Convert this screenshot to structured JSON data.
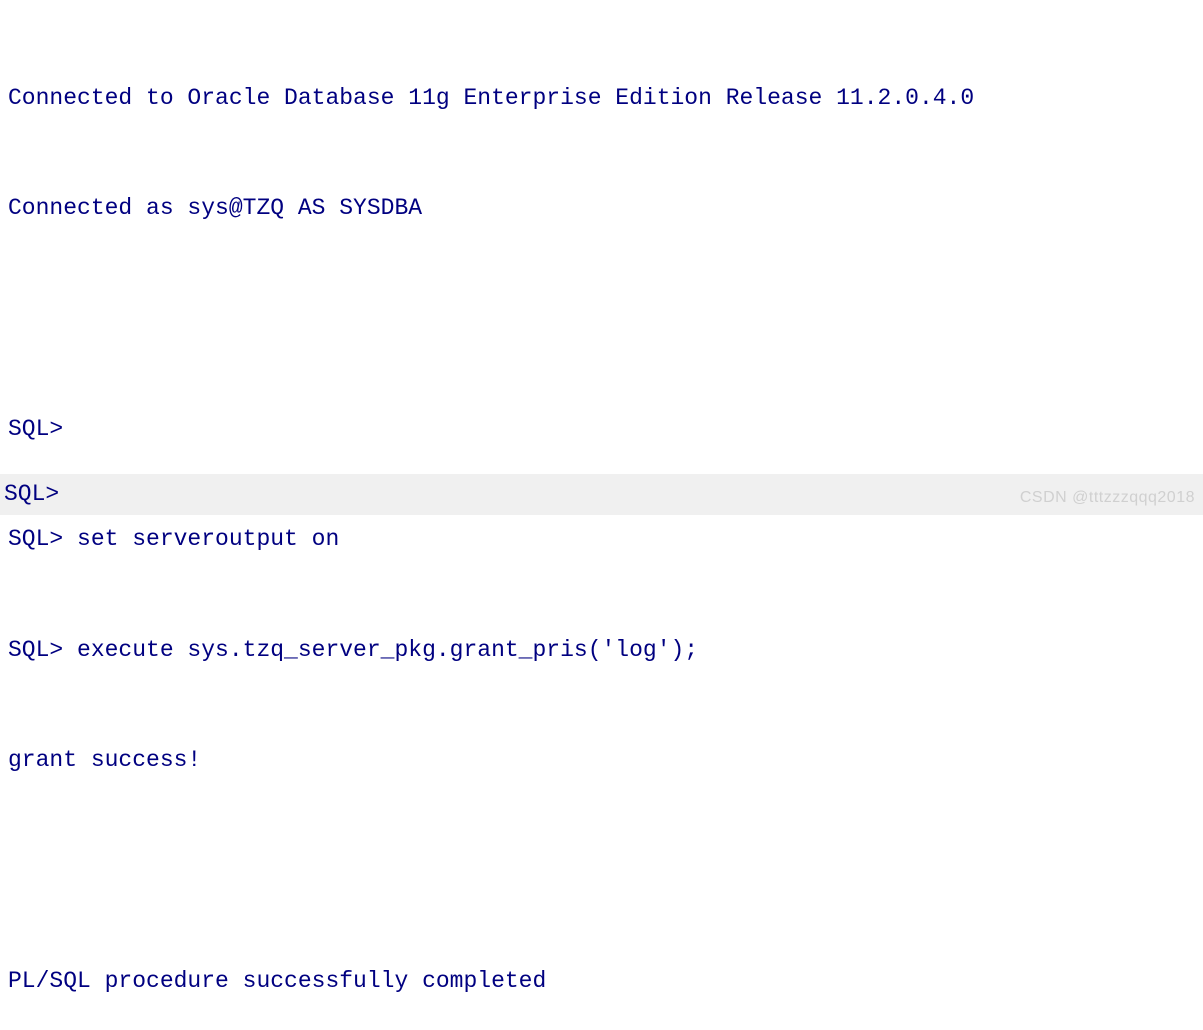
{
  "terminal": {
    "lines": {
      "l0": "Connected to Oracle Database 11g Enterprise Edition Release 11.2.0.4.0",
      "l1": "Connected as sys@TZQ AS SYSDBA",
      "l2": "SQL> ",
      "l3": "SQL> set serveroutput on",
      "l4": "SQL> execute sys.tzq_server_pkg.grant_pris('log');",
      "l5": "grant success!",
      "l6": "PL/SQL procedure successfully completed"
    },
    "active_prompt": "SQL> "
  },
  "watermark": "CSDN @tttzzzqqq2018"
}
